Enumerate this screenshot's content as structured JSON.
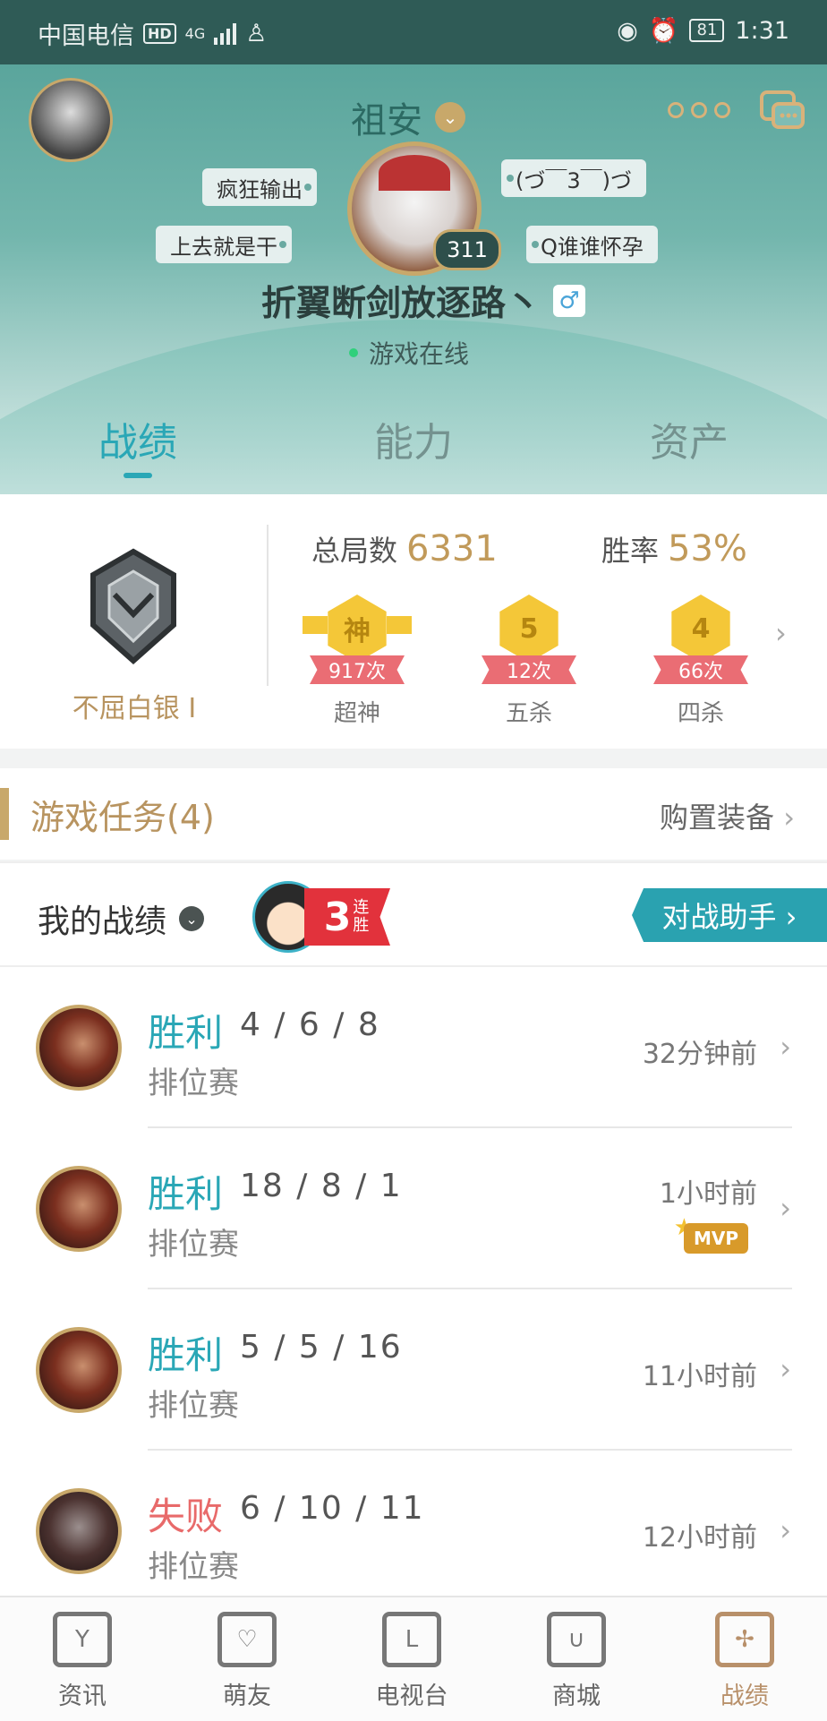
{
  "status_bar": {
    "carrier": "中国电信",
    "hd": "HD",
    "network": "4G",
    "battery": "81",
    "time": "1:31"
  },
  "profile": {
    "title": "祖安",
    "nickname": "折翼断剑放逐路丶",
    "gender_symbol": "♂",
    "level": "311",
    "online_status": "游戏在线",
    "tags": [
      "疯狂输出",
      "上去就是干",
      "(づ￣3￣)づ",
      "Q谁谁怀孕"
    ]
  },
  "tabs": [
    {
      "label": "战绩",
      "active": true
    },
    {
      "label": "能力",
      "active": false
    },
    {
      "label": "资产",
      "active": false
    }
  ],
  "stats": {
    "rank_name": "不屈白银 I",
    "total_games_label": "总局数",
    "total_games": "6331",
    "win_rate_label": "胜率",
    "win_rate": "53%",
    "medals": [
      {
        "glyph": "神",
        "count": "917次",
        "label": "超神"
      },
      {
        "glyph": "5",
        "count": "12次",
        "label": "五杀"
      },
      {
        "glyph": "4",
        "count": "66次",
        "label": "四杀"
      }
    ]
  },
  "tasks": {
    "title": "游戏任务(4)",
    "link": "购置装备"
  },
  "my_record": {
    "label": "我的战绩",
    "streak_number": "3",
    "streak_text": "连胜",
    "assist_button": "对战助手 ›"
  },
  "matches": [
    {
      "result": "胜利",
      "type": "win",
      "kda": "4 / 6 / 8",
      "mode": "排位赛",
      "time": "32分钟前",
      "mvp": false
    },
    {
      "result": "胜利",
      "type": "win",
      "kda": "18 / 8 / 1",
      "mode": "排位赛",
      "time": "1小时前",
      "mvp": true,
      "mvp_label": "MVP"
    },
    {
      "result": "胜利",
      "type": "win",
      "kda": "5 / 5 / 16",
      "mode": "排位赛",
      "time": "11小时前",
      "mvp": false
    },
    {
      "result": "失败",
      "type": "loss",
      "kda": "6 / 10 / 11",
      "mode": "排位赛",
      "time": "12小时前",
      "mvp": false
    }
  ],
  "nav": [
    {
      "label": "资讯",
      "icon": "news-icon",
      "active": false
    },
    {
      "label": "萌友",
      "icon": "friends-icon",
      "active": false
    },
    {
      "label": "电视台",
      "icon": "tv-icon",
      "active": false
    },
    {
      "label": "商城",
      "icon": "store-icon",
      "active": false
    },
    {
      "label": "战绩",
      "icon": "record-icon",
      "active": true
    }
  ],
  "colors": {
    "accent": "#2aa7b6",
    "gold": "#c8a86a",
    "loss": "#e86a6a",
    "header_teal": "#5aa59c"
  }
}
